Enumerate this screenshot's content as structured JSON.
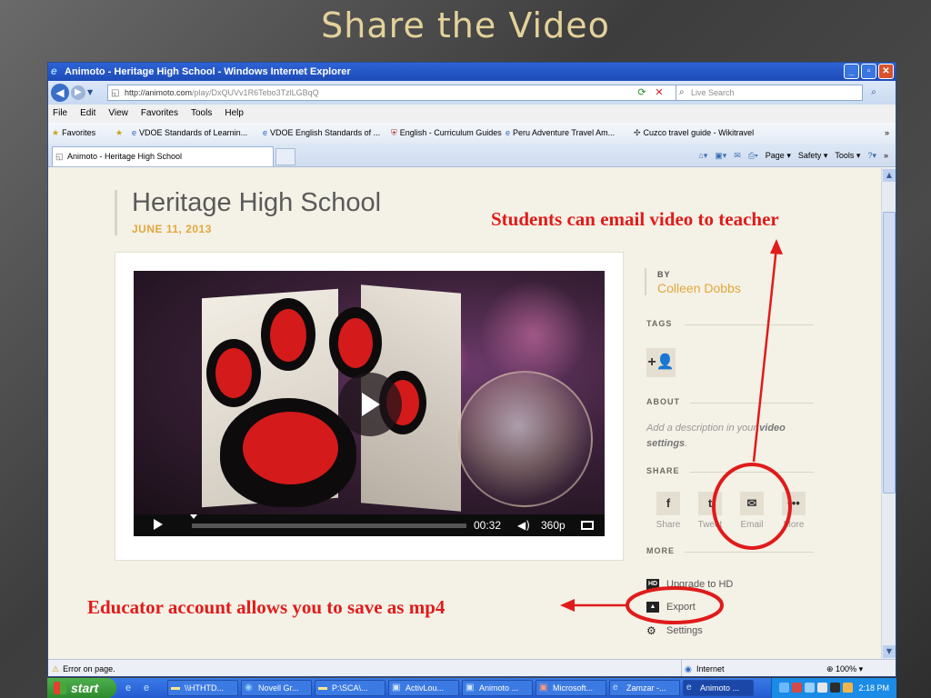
{
  "slide": {
    "title": "Share the Video",
    "callout_email": "Students can email video to teacher",
    "callout_export": "Educator account allows you to save as mp4"
  },
  "browser": {
    "window_title": "Animoto - Heritage High School - Windows Internet Explorer",
    "url_host": "http://animoto.com",
    "url_path": "/play/DxQUVv1R6Tebo3TzlLGBqQ",
    "search_placeholder": "Live Search",
    "menu": [
      "File",
      "Edit",
      "View",
      "Favorites",
      "Tools",
      "Help"
    ],
    "favorites_label": "Favorites",
    "favorites": [
      "VDOE Standards of Learnin...",
      "VDOE English Standards of ...",
      "English - Curriculum Guides",
      "Peru Adventure Travel Am...",
      "Cuzco travel guide - Wikitravel"
    ],
    "tab_label": "Animoto - Heritage High School",
    "commands": [
      "Page",
      "Safety",
      "Tools"
    ],
    "status_text": "Error on page.",
    "status_zone": "Internet",
    "status_zoom": "100%"
  },
  "page": {
    "heading": "Heritage High School",
    "date": "JUNE 11, 2013",
    "video": {
      "time": "00:32",
      "quality": "360p"
    },
    "by_label": "BY",
    "author": "Colleen Dobbs",
    "tags_label": "TAGS",
    "about_label": "ABOUT",
    "about_prefix": "Add a description in your ",
    "about_bold": "video settings",
    "about_suffix": ".",
    "share_label": "SHARE",
    "share_buttons": [
      "Share",
      "Tweet",
      "Email",
      "More"
    ],
    "more_label": "MORE",
    "more_items": [
      "Upgrade to HD",
      "Export",
      "Settings"
    ]
  },
  "taskbar": {
    "start_label": "start",
    "tasks": [
      "\\\\HTHTD...",
      "Novell Gr...",
      "P:\\SCA\\...",
      "ActivLou...",
      "Animoto ...",
      "Microsoft...",
      "Zamzar -...",
      "Animoto ..."
    ],
    "clock": "2:18 PM"
  },
  "colors": {
    "title_gold": "#e3d29a",
    "callout_red": "#e01b1b",
    "accent_orange": "#e2a83c"
  }
}
